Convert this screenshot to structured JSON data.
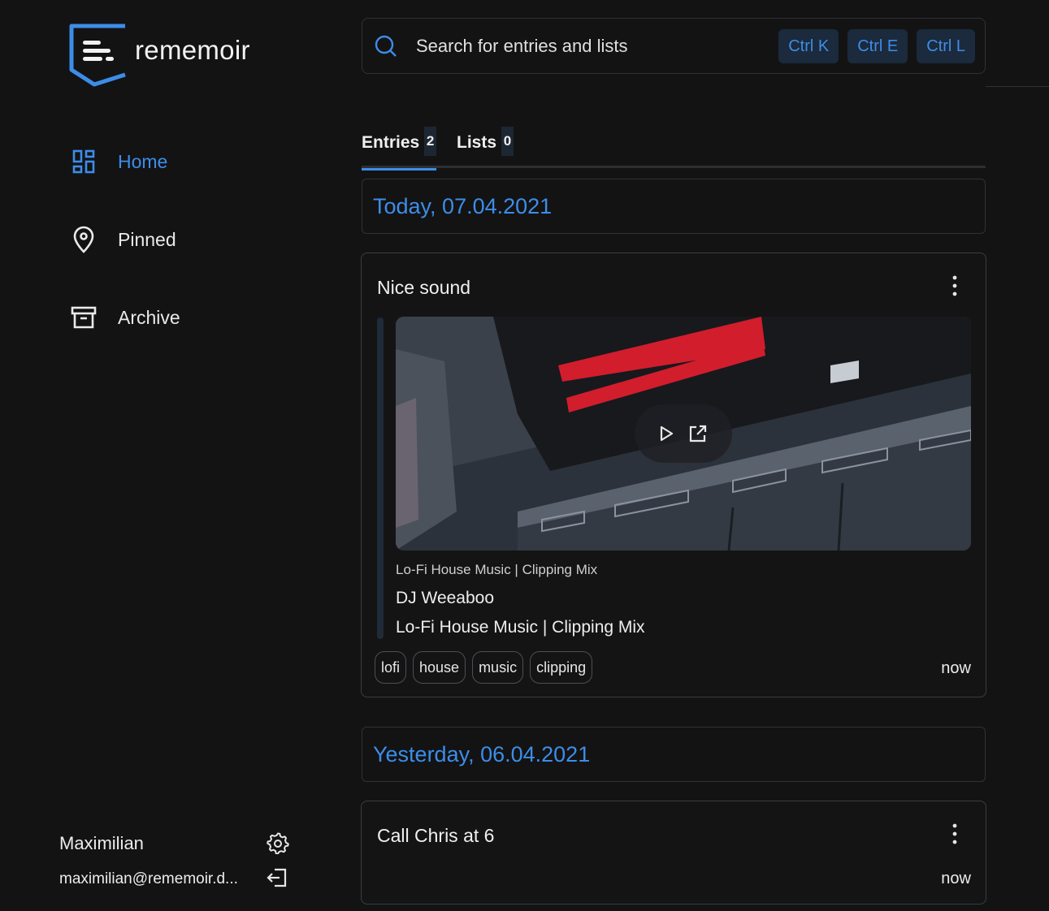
{
  "app": {
    "name": "rememoir",
    "brand_color": "#3d8de8"
  },
  "sidebar": {
    "items": [
      {
        "label": "Home",
        "icon": "dashboard-icon",
        "active": true
      },
      {
        "label": "Pinned",
        "icon": "map-pin-icon",
        "active": false
      },
      {
        "label": "Archive",
        "icon": "archive-icon",
        "active": false
      }
    ],
    "user": {
      "name": "Maximilian",
      "email": "maximilian@rememoir.d..."
    }
  },
  "search": {
    "placeholder": "Search for entries and lists",
    "shortcuts": [
      "Ctrl K",
      "Ctrl E",
      "Ctrl L"
    ]
  },
  "tabs": [
    {
      "label": "Entries",
      "count": "2",
      "active": true
    },
    {
      "label": "Lists",
      "count": "0",
      "active": false
    }
  ],
  "groups": [
    {
      "date_label": "Today, 07.04.2021",
      "entries": [
        {
          "title": "Nice sound",
          "embed": {
            "site": "Lo-Fi House Music | Clipping Mix",
            "author": "DJ Weeaboo",
            "title": "Lo-Fi House Music | Clipping Mix"
          },
          "tags": [
            "lofi",
            "house",
            "music",
            "clipping"
          ],
          "time": "now"
        }
      ]
    },
    {
      "date_label": "Yesterday, 06.04.2021",
      "entries": [
        {
          "title": "Call Chris at 6",
          "time": "now"
        }
      ]
    }
  ]
}
